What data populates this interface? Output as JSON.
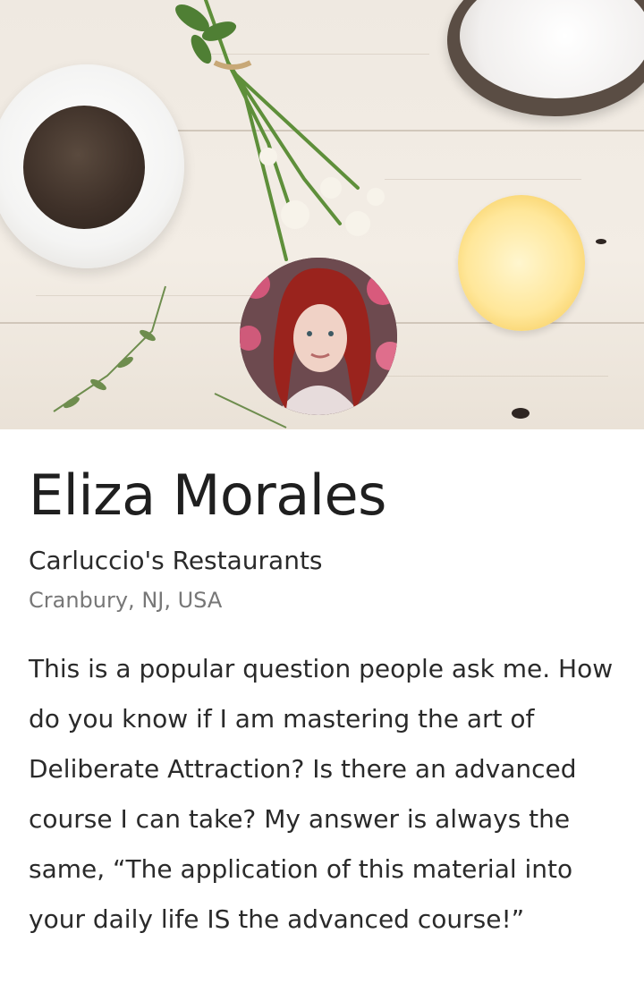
{
  "profile": {
    "name": "Eliza Morales",
    "company": "Carluccio's Restaurants",
    "location": "Cranbury, NJ, USA",
    "bio": "This is a popular question people ask me. How do you know if I am mastering the art of Deliberate Attraction? Is there an advanced course I can take? My answer is always the same, “The application of this material into your daily life IS the advanced course!”"
  }
}
